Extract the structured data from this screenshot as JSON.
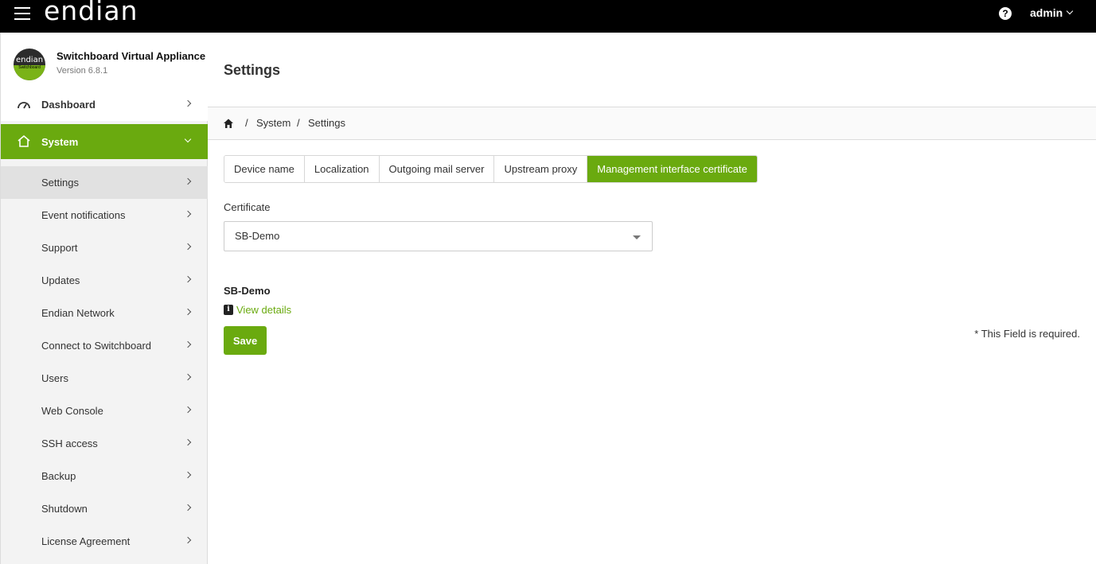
{
  "topbar": {
    "logo": "endian",
    "user": "admin"
  },
  "appliance": {
    "name": "Switchboard Virtual Appliance",
    "version": "Version 6.8.1",
    "badge_top": "endian",
    "badge_strip": "Switchboard"
  },
  "sidebar": {
    "dashboard": "Dashboard",
    "system": "System",
    "items": [
      {
        "label": "Settings"
      },
      {
        "label": "Event notifications"
      },
      {
        "label": "Support"
      },
      {
        "label": "Updates"
      },
      {
        "label": "Endian Network"
      },
      {
        "label": "Connect to Switchboard"
      },
      {
        "label": "Users"
      },
      {
        "label": "Web Console"
      },
      {
        "label": "SSH access"
      },
      {
        "label": "Backup"
      },
      {
        "label": "Shutdown"
      },
      {
        "label": "License Agreement"
      }
    ]
  },
  "page": {
    "title": "Settings"
  },
  "breadcrumb": {
    "items": [
      "System",
      "Settings"
    ]
  },
  "tabs": [
    {
      "label": "Device name"
    },
    {
      "label": "Localization"
    },
    {
      "label": "Outgoing mail server"
    },
    {
      "label": "Upstream proxy"
    },
    {
      "label": "Management interface certificate",
      "active": true
    }
  ],
  "form": {
    "certificate_label": "Certificate",
    "certificate_value": "SB-Demo",
    "cert_name": "SB-Demo",
    "view_details": "View details",
    "save_label": "Save",
    "required_note": "* This Field is required."
  },
  "colors": {
    "accent": "#6aaa0f",
    "topbar": "#000000"
  }
}
